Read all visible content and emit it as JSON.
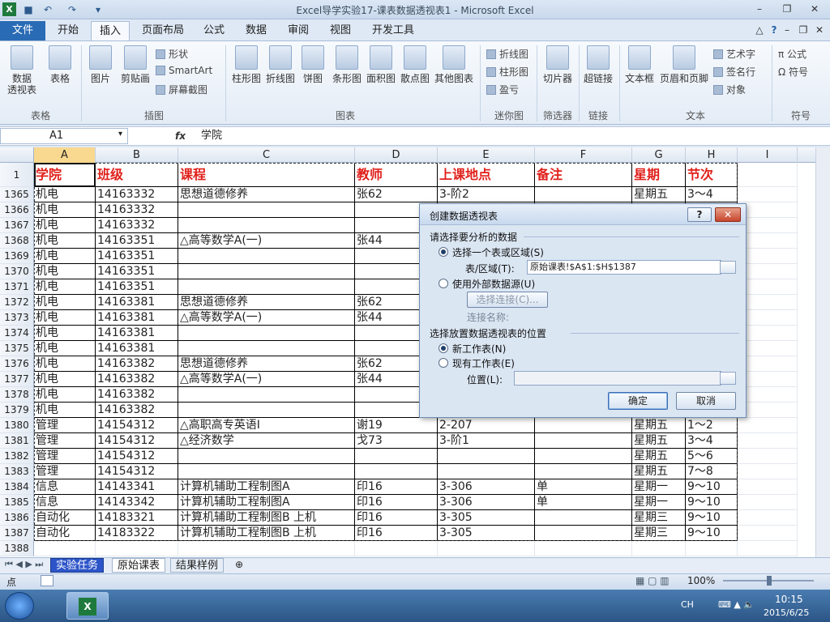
{
  "window": {
    "title": "Excel导学实验17-课表数据透视表1  -  Microsoft Excel",
    "app_icon": "X"
  },
  "qat": {
    "save": "■",
    "undo": "↶",
    "redo": "↷",
    "customize": "▾"
  },
  "tabs": [
    "文件",
    "开始",
    "插入",
    "页面布局",
    "公式",
    "数据",
    "审阅",
    "视图",
    "开发工具"
  ],
  "ribbon": {
    "groups": [
      "表格",
      "插图",
      "图表",
      "迷你图",
      "筛选器",
      "链接",
      "文本",
      "符号"
    ],
    "table_buttons": [
      "数据\n透视表",
      "表格"
    ],
    "illus_buttons": [
      "图片",
      "剪贴画"
    ],
    "illus_small": [
      "形状",
      "SmartArt",
      "屏幕截图"
    ],
    "chart_buttons": [
      "柱形图",
      "折线图",
      "饼图",
      "条形图",
      "面积图",
      "散点图",
      "其他图表"
    ],
    "spark_small": [
      "折线图",
      "柱形图",
      "盈亏"
    ],
    "filter_button": "切片器",
    "link_button": "超链接",
    "text_buttons": [
      "文本框",
      "页眉和页脚"
    ],
    "text_small": [
      "艺术字",
      "签名行",
      "对象"
    ],
    "symbol_small": [
      "公式",
      "符号"
    ]
  },
  "formula": {
    "namebox": "A1",
    "fx": "fx",
    "content": "学院"
  },
  "columns": [
    "A",
    "B",
    "C",
    "D",
    "E",
    "F",
    "G",
    "H",
    "I"
  ],
  "header_row": {
    "rownum": "1",
    "cells": [
      "学院",
      "班级",
      "课程",
      "教师",
      "上课地点",
      "备注",
      "星期",
      "节次"
    ]
  },
  "rows": [
    [
      "1365",
      "机电",
      "14163332",
      "思想道德修养",
      "张62",
      "3-阶2",
      "",
      "星期五",
      "3～4"
    ],
    [
      "1366",
      "机电",
      "14163332",
      "",
      "",
      "",
      "",
      "",
      ""
    ],
    [
      "1367",
      "机电",
      "14163332",
      "",
      "",
      "",
      "",
      "",
      ""
    ],
    [
      "1368",
      "机电",
      "14163351",
      "△高等数学A(一)",
      "张44",
      "",
      "",
      "",
      ""
    ],
    [
      "1369",
      "机电",
      "14163351",
      "",
      "",
      "",
      "",
      "",
      ""
    ],
    [
      "1370",
      "机电",
      "14163351",
      "",
      "",
      "",
      "",
      "",
      ""
    ],
    [
      "1371",
      "机电",
      "14163351",
      "",
      "",
      "",
      "",
      "",
      ""
    ],
    [
      "1372",
      "机电",
      "14163381",
      "思想道德修养",
      "张62",
      "",
      "",
      "",
      ""
    ],
    [
      "1373",
      "机电",
      "14163381",
      "△高等数学A(一)",
      "张44",
      "",
      "",
      "",
      ""
    ],
    [
      "1374",
      "机电",
      "14163381",
      "",
      "",
      "",
      "",
      "",
      ""
    ],
    [
      "1375",
      "机电",
      "14163381",
      "",
      "",
      "",
      "",
      "",
      ""
    ],
    [
      "1376",
      "机电",
      "14163382",
      "思想道德修养",
      "张62",
      "",
      "",
      "",
      ""
    ],
    [
      "1377",
      "机电",
      "14163382",
      "△高等数学A(一)",
      "张44",
      "",
      "",
      "",
      ""
    ],
    [
      "1378",
      "机电",
      "14163382",
      "",
      "",
      "",
      "",
      "",
      ""
    ],
    [
      "1379",
      "机电",
      "14163382",
      "",
      "",
      "",
      "",
      "",
      ""
    ],
    [
      "1380",
      "管理",
      "14154312",
      "△高职高专英语Ⅰ",
      "谢19",
      "2-207",
      "",
      "星期五",
      "1～2"
    ],
    [
      "1381",
      "管理",
      "14154312",
      "△经济数学",
      "戈73",
      "3-阶1",
      "",
      "星期五",
      "3～4"
    ],
    [
      "1382",
      "管理",
      "14154312",
      "",
      "",
      "",
      "",
      "星期五",
      "5～6"
    ],
    [
      "1383",
      "管理",
      "14154312",
      "",
      "",
      "",
      "",
      "星期五",
      "7～8"
    ],
    [
      "1384",
      "信息",
      "14143341",
      "计算机辅助工程制图A",
      "印16",
      "3-306",
      "单",
      "星期一",
      "9～10"
    ],
    [
      "1385",
      "信息",
      "14143342",
      "计算机辅助工程制图A",
      "印16",
      "3-306",
      "单",
      "星期一",
      "9～10"
    ],
    [
      "1386",
      "自动化",
      "14183321",
      "计算机辅助工程制图B 上机",
      "印16",
      "3-305",
      "",
      "星期三",
      "9～10"
    ],
    [
      "1387",
      "自动化",
      "14183322",
      "计算机辅助工程制图B 上机",
      "印16",
      "3-305",
      "",
      "星期三",
      "9～10"
    ],
    [
      "1388",
      "",
      "",
      "",
      "",
      "",
      "",
      "",
      ""
    ]
  ],
  "sheet_tabs": [
    "实验任务",
    "原始课表",
    "结果样例"
  ],
  "status": {
    "mode": "点",
    "zoom": "100%"
  },
  "taskbar": {
    "lang": "CH",
    "time": "10:15",
    "date": "2015/6/25"
  },
  "dialog": {
    "title": "创建数据透视表",
    "help": "?",
    "close": "✕",
    "section1": "请选择要分析的数据",
    "opt_table": "选择一个表或区域(S)",
    "range_label": "表/区域(T):",
    "range_value": "原始课表!$A$1:$H$1387",
    "opt_external": "使用外部数据源(U)",
    "choose_conn": "选择连接(C)...",
    "conn_name": "连接名称:",
    "section2": "选择放置数据透视表的位置",
    "opt_new": "新工作表(N)",
    "opt_existing": "现有工作表(E)",
    "location_label": "位置(L):",
    "ok": "确定",
    "cancel": "取消"
  }
}
